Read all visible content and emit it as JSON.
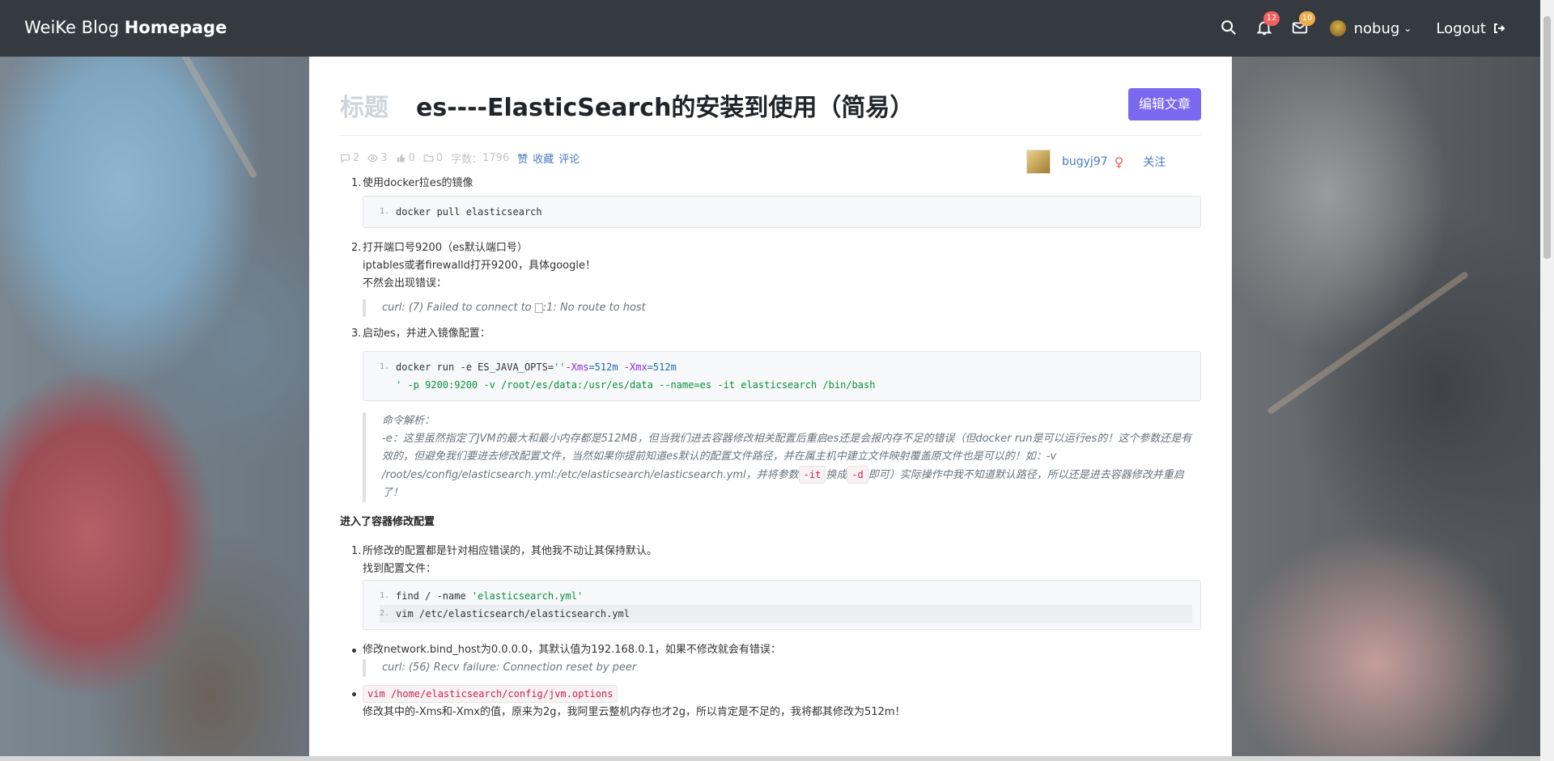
{
  "navbar": {
    "brand_light": "WeiKe Blog ",
    "brand_bold": "Homepage",
    "notifications_count": "12",
    "messages_count": "10",
    "username": "nobug",
    "logout_label": "Logout"
  },
  "post": {
    "title_label": "标题",
    "title": "es----ElasticSearch的安装到使用（简易）",
    "edit_button": "编辑文章",
    "meta": {
      "comments": "2",
      "views": "3",
      "likes": "0",
      "folders": "0",
      "word_count_label": "字数：",
      "word_count": "1796",
      "like_action": "赞",
      "collect_action": "收藏",
      "comment_action": "评论"
    },
    "author": {
      "name": "bugyj97",
      "follow_label": "关注"
    }
  },
  "content": {
    "step1": "使用docker拉es的镜像",
    "code1": [
      "docker pull elasticsearch"
    ],
    "step2_lines": [
      "打开端口号9200（es默认端口号）",
      "iptables或者firewalld打开9200，具体google！",
      "不然会出现错误："
    ],
    "quote1": "curl: (7) Failed to connect to ",
    "quote1_tail": ":1: No route to host",
    "step3": "启动es，并进入镜像配置：",
    "code2_line1_a": "docker run -e ES_JAVA_OPTS=",
    "code2_line1_b": "''",
    "code2_line1_c": "-Xms",
    "code2_line1_d": "=512m",
    "code2_line1_e": " -Xmx",
    "code2_line1_f": "=512m",
    "code2_line2": "' -p 9200:9200 -v /root/es/data:/usr/es/data --name=es -it elasticsearch /bin/bash",
    "quote2_title": "命令解析：",
    "quote2_body": "-e：这里虽然指定了JVM的最大和最小内存都是512MB，但当我们进去容器修改相关配置后重启es还是会报内存不足的错误（但docker run是可以运行es的！这个参数还是有效的，但避免我们要进去修改配置文件，当然如果你提前知道es默认的配置文件路径，并在属主机中建立文件映射覆盖原文件也是可以的！如：-v /root/es/config/elasticsearch.yml:/etc/elasticsearch/elasticsearch.yml，并将参数",
    "quote2_code1": "-it",
    "quote2_mid": "换成",
    "quote2_code2": "-d",
    "quote2_tail": "即可）实际操作中我不知道默认路径，所以还是进去容器修改并重启了！",
    "section_heading": "进入了容器修改配置",
    "step4": "所修改的配置都是针对相应错误的，其他我不动让其保持默认。",
    "step4_sub": "找到配置文件：",
    "code3_line1_a": "find / -name ",
    "code3_line1_b": "'elasticsearch.yml'",
    "code3_line2": "vim /etc/elasticsearch/elasticsearch.yml",
    "bullet1": "修改network.bind_host为0.0.0.0，其默认值为192.168.0.1，如果不修改就会有错误：",
    "bullet1_quote": "curl: (56) Recv failure: Connection reset by peer",
    "bullet2_code": "vim /home/elasticsearch/config/jvm.options",
    "bullet2_text": "修改其中的-Xms和-Xmx的值，原来为2g，我阿里云整机内存也才2g，所以肯定是不足的，我将都其修改为512m！"
  },
  "colors": {
    "navbar_bg": "#343a40",
    "accent_button": "#7b68ee",
    "link": "#4a7bbf",
    "badge_red": "#f4605f",
    "badge_yellow": "#f0ad4e"
  }
}
